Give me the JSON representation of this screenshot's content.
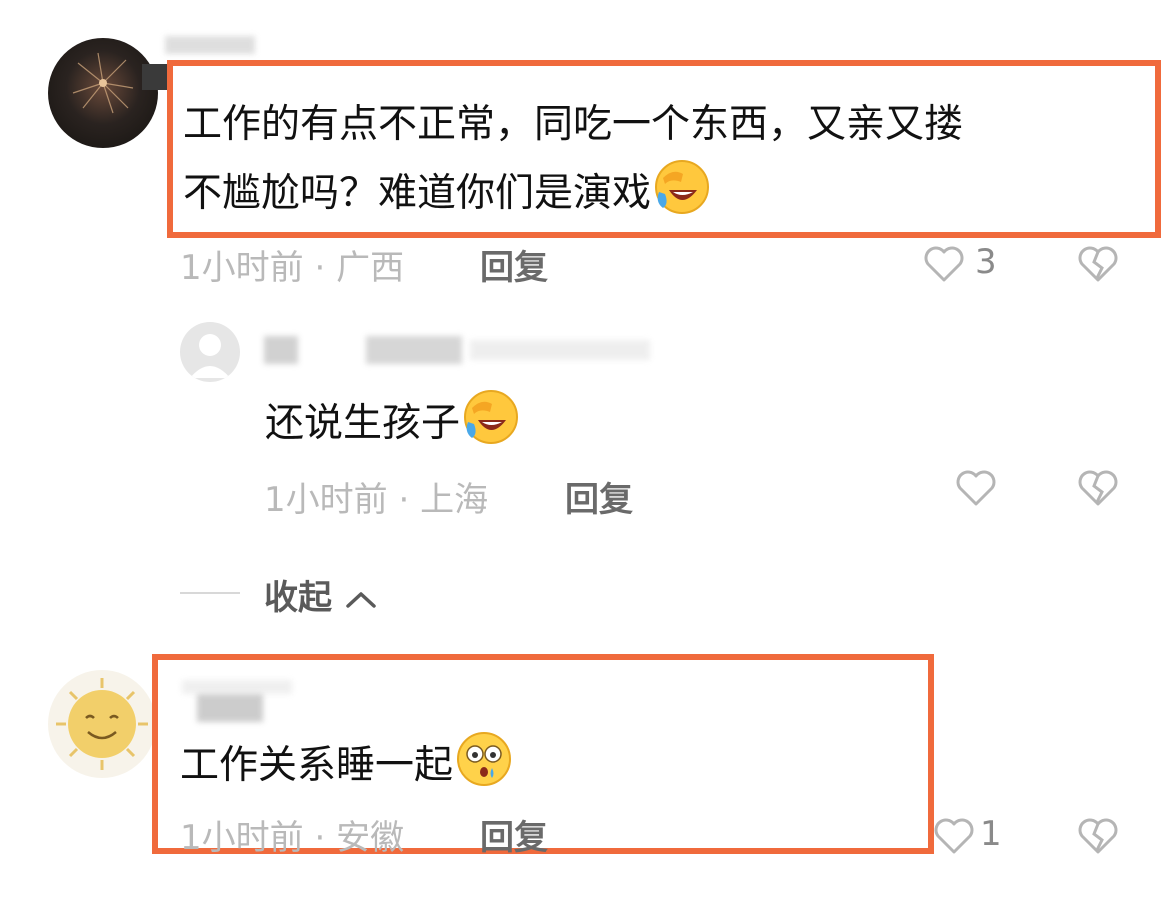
{
  "comments": [
    {
      "text_line1": "工作的有点不正常，同吃一个东西，又亲又搂",
      "text_line2": "不尴尬吗？难道你们是演戏",
      "emoji": "laughing-crying-emoji",
      "time": "1小时前",
      "location": "广西",
      "reply_label": "回复",
      "likes": "3"
    },
    {
      "text": "还说生孩子",
      "emoji": "laughing-crying-emoji",
      "time": "1小时前",
      "location": "上海",
      "reply_label": "回复"
    },
    {
      "text": "工作关系睡一起",
      "emoji": "shocked-emoji",
      "time": "1小时前",
      "location": "安徽",
      "reply_label": "回复",
      "likes": "1"
    }
  ],
  "collapse": {
    "label": "收起"
  },
  "colors": {
    "highlight": "#f06a3c",
    "meta": "#b9b9b9"
  }
}
